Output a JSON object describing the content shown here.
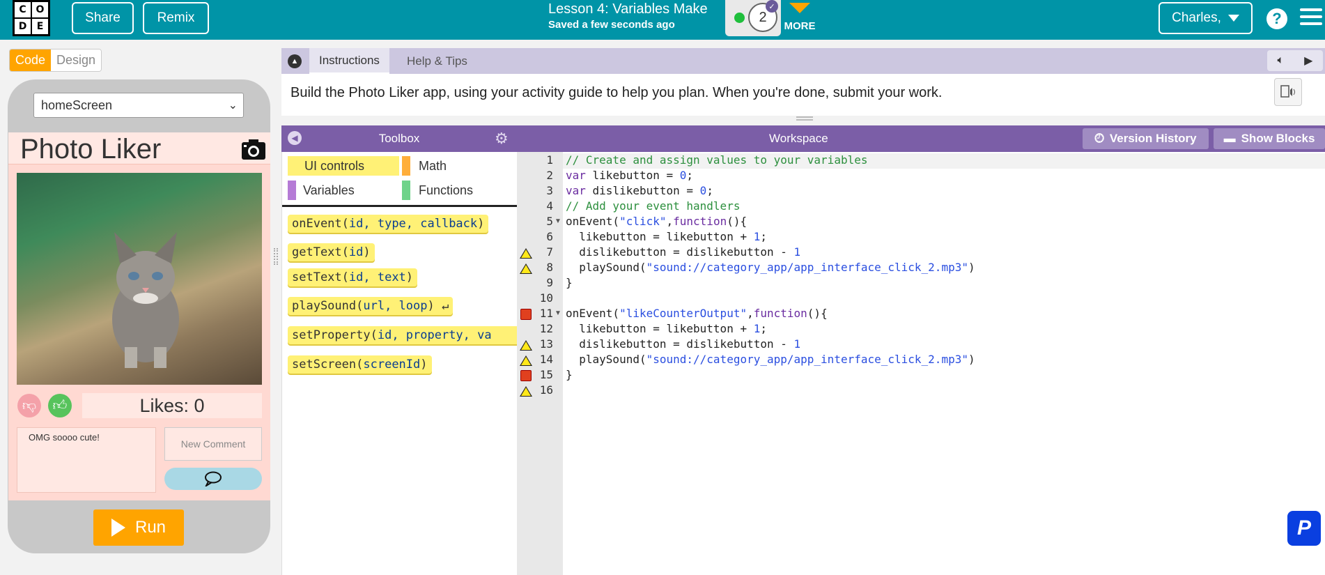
{
  "header": {
    "logo_letters": [
      "C",
      "O",
      "D",
      "E"
    ],
    "share_label": "Share",
    "remix_label": "Remix",
    "lesson_title": "Lesson 4: Variables Make",
    "saved_status": "Saved a few seconds ago",
    "progress_level": "2",
    "more_label": "MORE",
    "user_label": "Charles,",
    "help_label": "?"
  },
  "mode_toggle": {
    "code": "Code",
    "design": "Design"
  },
  "app_preview": {
    "screen_select": "homeScreen",
    "title": "Photo Liker",
    "likes_text": "Likes: 0",
    "comment_text": "OMG soooo cute!",
    "new_comment_placeholder": "New Comment",
    "run_label": "Run"
  },
  "instructions": {
    "tab_instructions": "Instructions",
    "tab_help": "Help & Tips",
    "text": "Build the Photo Liker app, using your activity guide to help you plan. When you're done, submit your work."
  },
  "toolbox": {
    "title": "Toolbox",
    "categories": [
      {
        "label": "UI controls",
        "color": "#fff176"
      },
      {
        "label": "Math",
        "color": "#ffae3b"
      },
      {
        "label": "Variables",
        "color": "#b57bd6"
      },
      {
        "label": "Functions",
        "color": "#6fd38a"
      }
    ],
    "blocks": [
      {
        "name": "onEvent",
        "params": "id, type, callback"
      },
      {
        "name": "getText",
        "params": "id"
      },
      {
        "name": "setText",
        "params": "id, text"
      },
      {
        "name": "playSound",
        "params": "url, loop"
      },
      {
        "name": "setProperty",
        "params": "id, property, va"
      },
      {
        "name": "setScreen",
        "params": "screenId"
      }
    ]
  },
  "workspace": {
    "title": "Workspace",
    "version_history": "Version History",
    "show_blocks": "Show Blocks",
    "code_lines": [
      {
        "n": "1",
        "marker": "",
        "fold": false,
        "text": "// Create and assign values to your variables"
      },
      {
        "n": "2",
        "marker": "",
        "fold": false,
        "text": "var likebutton = 0;"
      },
      {
        "n": "3",
        "marker": "",
        "fold": false,
        "text": "var dislikebutton = 0;"
      },
      {
        "n": "4",
        "marker": "",
        "fold": false,
        "text": "// Add your event handlers"
      },
      {
        "n": "5",
        "marker": "",
        "fold": true,
        "text": "onEvent(\"click\",function(){"
      },
      {
        "n": "6",
        "marker": "",
        "fold": false,
        "text": "  likebutton = likebutton + 1;"
      },
      {
        "n": "7",
        "marker": "warn",
        "fold": false,
        "text": "  dislikebutton = dislikebutton - 1"
      },
      {
        "n": "8",
        "marker": "warn",
        "fold": false,
        "text": "  playSound(\"sound://category_app/app_interface_click_2.mp3\")"
      },
      {
        "n": "9",
        "marker": "",
        "fold": false,
        "text": "}"
      },
      {
        "n": "10",
        "marker": "",
        "fold": false,
        "text": ""
      },
      {
        "n": "11",
        "marker": "err",
        "fold": true,
        "text": "onEvent(\"likeCounterOutput\",function(){"
      },
      {
        "n": "12",
        "marker": "",
        "fold": false,
        "text": "  likebutton = likebutton + 1;"
      },
      {
        "n": "13",
        "marker": "warn",
        "fold": false,
        "text": "  dislikebutton = dislikebutton - 1"
      },
      {
        "n": "14",
        "marker": "warn",
        "fold": false,
        "text": "  playSound(\"sound://category_app/app_interface_click_2.mp3\")"
      },
      {
        "n": "15",
        "marker": "err",
        "fold": false,
        "text": "}"
      },
      {
        "n": "16",
        "marker": "warn",
        "fold": false,
        "text": ""
      }
    ]
  },
  "badge_letter": "P"
}
